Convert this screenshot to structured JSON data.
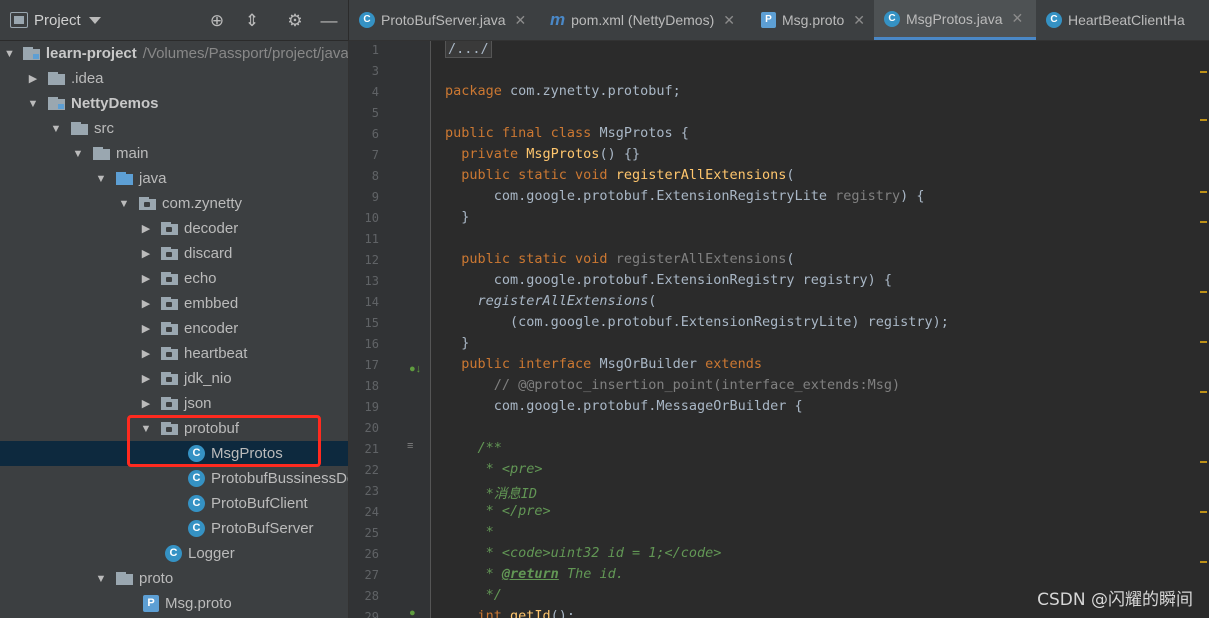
{
  "project_panel": {
    "title": "Project",
    "tree": [
      {
        "label": "learn-project",
        "path": "/Volumes/Passport/project/java",
        "icon": "folder-module",
        "expanded": true
      },
      {
        "label": ".idea",
        "icon": "folder",
        "expanded": false
      },
      {
        "label": "NettyDemos",
        "icon": "folder-module",
        "expanded": true
      },
      {
        "label": "src",
        "icon": "folder",
        "expanded": true
      },
      {
        "label": "main",
        "icon": "folder",
        "expanded": true
      },
      {
        "label": "java",
        "icon": "folder-source",
        "expanded": true
      },
      {
        "label": "com.zynetty",
        "icon": "package",
        "expanded": true
      },
      {
        "label": "decoder",
        "icon": "package",
        "expanded": false
      },
      {
        "label": "discard",
        "icon": "package",
        "expanded": false
      },
      {
        "label": "echo",
        "icon": "package",
        "expanded": false
      },
      {
        "label": "embbed",
        "icon": "package",
        "expanded": false
      },
      {
        "label": "encoder",
        "icon": "package",
        "expanded": false
      },
      {
        "label": "heartbeat",
        "icon": "package",
        "expanded": false
      },
      {
        "label": "jdk_nio",
        "icon": "package",
        "expanded": false
      },
      {
        "label": "json",
        "icon": "package",
        "expanded": false
      },
      {
        "label": "protobuf",
        "icon": "package",
        "expanded": true
      },
      {
        "label": "MsgProtos",
        "icon": "class",
        "selected": true
      },
      {
        "label": "ProtobufBussinessDe",
        "icon": "class"
      },
      {
        "label": "ProtoBufClient",
        "icon": "class"
      },
      {
        "label": "ProtoBufServer",
        "icon": "class"
      },
      {
        "label": "Logger",
        "icon": "class"
      },
      {
        "label": "proto",
        "icon": "folder",
        "expanded": true
      },
      {
        "label": "Msg.proto",
        "icon": "proto-file"
      }
    ]
  },
  "tabs": [
    {
      "label": "ProtoBufServer.java",
      "icon": "class-icon",
      "active": false
    },
    {
      "label": "pom.xml (NettyDemos)",
      "icon": "maven-icon",
      "active": false
    },
    {
      "label": "Msg.proto",
      "icon": "proto-icon",
      "active": false
    },
    {
      "label": "MsgProtos.java",
      "icon": "class-icon",
      "active": true
    },
    {
      "label": "HeartBeatClientHa",
      "icon": "class-icon",
      "active": false
    }
  ],
  "editor": {
    "line_numbers": [
      "1",
      "3",
      "4",
      "6",
      "7",
      "8",
      "9",
      "10",
      "11",
      "12",
      "13",
      "14",
      "15",
      "16",
      "17",
      "18",
      "19",
      "20",
      "21",
      "22",
      "23",
      "24",
      "25",
      "26",
      "27",
      "28"
    ],
    "lines": {
      "l1": "/.../",
      "l4a": "package ",
      "l4b": "com.zynetty.protobuf;",
      "l6a": "public final class ",
      "l6b": "MsgProtos",
      "l6c": " {",
      "l7a": "  private ",
      "l7b": "MsgProtos",
      "l7c": "() {}",
      "l8a": "  public static void ",
      "l8b": "registerAllExtensions",
      "l8c": "(",
      "l9a": "      com.google.protobuf.ExtensionRegistryLite ",
      "l9b": "registry",
      "l9c": ") {",
      "l10": "  }",
      "l12a": "  public static void ",
      "l12b": "registerAllExtensions",
      "l12c": "(",
      "l13": "      com.google.protobuf.ExtensionRegistry registry) {",
      "l14a": "    ",
      "l14b": "registerAllExtensions",
      "l14c": "(",
      "l15": "        (com.google.protobuf.ExtensionRegistryLite) registry);",
      "l16": "  }",
      "l17a": "  public interface ",
      "l17b": "MsgOrBuilder ",
      "l17c": "extends",
      "l18": "      // @@protoc_insertion_point(interface_extends:Msg)",
      "l19": "      com.google.protobuf.MessageOrBuilder {",
      "l21": "    /**",
      "l22": "     * <pre>",
      "l23": "     *消息ID",
      "l24": "     * </pre>",
      "l25": "     *",
      "l26a": "     * <code>",
      "l26b": "uint32 id = 1;",
      "l26c": "</code>",
      "l27a": "     * ",
      "l27b": "@return",
      "l27c": " The id.",
      "l28": "     */",
      "l29a": "    int ",
      "l29b": "getId",
      "l29c": "();"
    }
  },
  "watermark": "CSDN @闪耀的瞬间",
  "colors": {
    "highlight": "#ff2a1f",
    "selection": "#0d293e",
    "active_tab_underline": "#4a88c7"
  }
}
